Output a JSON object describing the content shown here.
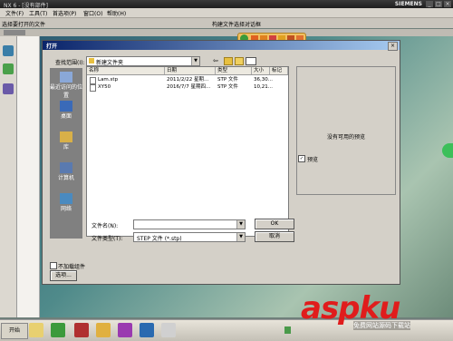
{
  "app": {
    "title": "NX 6 - [没有部件]",
    "brand": "SIEMENS",
    "menu": [
      "文件(F)",
      "工具(T)",
      "首选项(P)",
      "窗口(O)",
      "帮助(H)"
    ],
    "cmdbar_left": "选择要打开的文件",
    "cmdbar_center": "构建文件选择对话框"
  },
  "dialog": {
    "title": "打开",
    "look_in_label": "查找范围(I):",
    "look_in_value": "新建文件夹",
    "columns": [
      "名称",
      "日期",
      "类型",
      "大小",
      "标记"
    ],
    "files": [
      {
        "name": "Lam.stp",
        "date": "2011/2/22 星期...",
        "type": "STP 文件",
        "size": "36,30..."
      },
      {
        "name": "XY50",
        "date": "2016/7/7 星期四...",
        "type": "STP 文件",
        "size": "10,21..."
      }
    ],
    "places": [
      "最近访问的位置",
      "桌面",
      "库",
      "计算机",
      "网络"
    ],
    "preview_text": "没有可用的预览",
    "preview_checkbox_label": "预览",
    "preview_checked": true,
    "filename_label": "文件名(N):",
    "filename_value": "",
    "filetype_label": "文件类型(T):",
    "filetype_value": "STEP 文件 (*.stp)",
    "ok_label": "OK",
    "cancel_label": "取消",
    "no_load_label": "不加载组件",
    "no_load_checked": false,
    "options_label": "选项..."
  },
  "taskbar": {
    "start_label": "开始"
  },
  "watermark": {
    "main": "aspku",
    "sub": "免费网站源码下载站"
  }
}
